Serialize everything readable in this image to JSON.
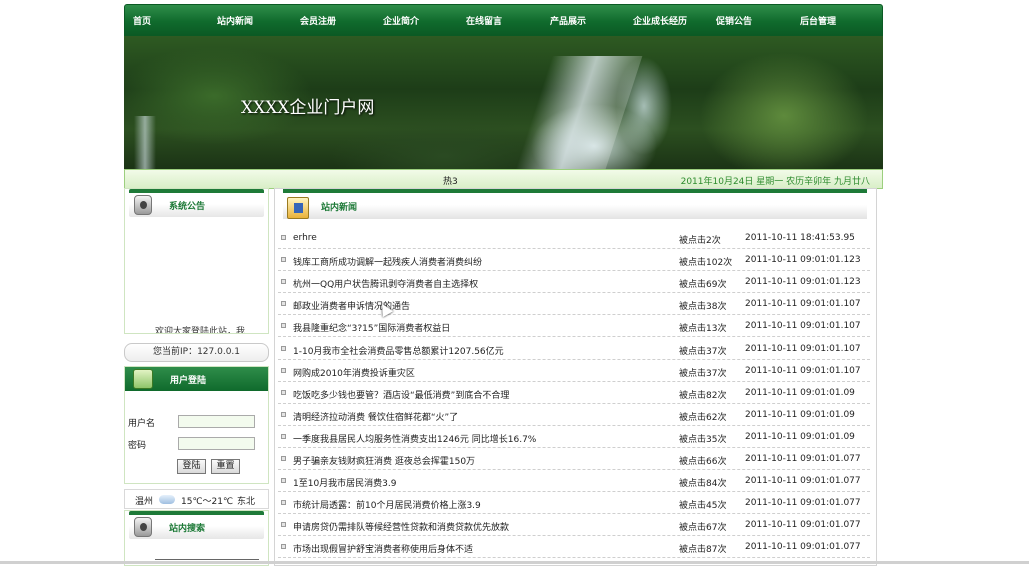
{
  "nav": [
    "首页",
    "站内新闻",
    "会员注册",
    "企业简介",
    "在线留言",
    "产品展示",
    "企业成长经历",
    "促销公告",
    "后台管理"
  ],
  "banner": {
    "title": "XXXX企业门户网"
  },
  "status": {
    "hot": "热3",
    "date": "2011年10月24日 星期一 农历辛卯年 九月廿八"
  },
  "notice": {
    "title": "系统公告",
    "scroll_text": "欢迎大家登陆此站，我"
  },
  "ip": {
    "text": "您当前IP：127.0.0.1"
  },
  "login": {
    "title": "用户登陆",
    "username_label": "用户名",
    "password_label": "密码",
    "username_value": "",
    "password_value": "",
    "login_button": "登陆",
    "reset_button": "重置"
  },
  "weather": {
    "city": "温州",
    "icon": "cloud-icon",
    "temp": "15℃～21℃",
    "wind": "东北"
  },
  "search": {
    "title": "站内搜索"
  },
  "news": {
    "title": "站内新闻",
    "rows": [
      {
        "title": "erhre",
        "clicks": "被点击2次",
        "date": "2011-10-11 18:41:53.95"
      },
      {
        "title": "钱库工商所成功调解一起残疾人消费者消费纠纷",
        "clicks": "被点击102次",
        "date": "2011-10-11 09:01:01.123"
      },
      {
        "title": "杭州一QQ用户状告腾讯剥夺消费者自主选择权",
        "clicks": "被点击69次",
        "date": "2011-10-11 09:01:01.123"
      },
      {
        "title": "邮政业消费者申诉情况的通告",
        "clicks": "被点击38次",
        "date": "2011-10-11 09:01:01.107"
      },
      {
        "title": "我县隆重纪念“3?15”国际消费者权益日",
        "clicks": "被点击13次",
        "date": "2011-10-11 09:01:01.107"
      },
      {
        "title": "1-10月我市全社会消费品零售总额累计1207.56亿元",
        "clicks": "被点击37次",
        "date": "2011-10-11 09:01:01.107"
      },
      {
        "title": "网购成2010年消费投诉重灾区",
        "clicks": "被点击37次",
        "date": "2011-10-11 09:01:01.107"
      },
      {
        "title": "吃饭吃多少钱也要管？酒店设“最低消费”到底合不合理",
        "clicks": "被点击82次",
        "date": "2011-10-11 09:01:01.09"
      },
      {
        "title": "清明经济拉动消费 餐饮住宿鲜花都“火”了",
        "clicks": "被点击62次",
        "date": "2011-10-11 09:01:01.09"
      },
      {
        "title": "一季度我县居民人均服务性消费支出1246元 同比增长16.7%",
        "clicks": "被点击35次",
        "date": "2011-10-11 09:01:01.09"
      },
      {
        "title": "男子骗亲友钱财疯狂消费 逛夜总会挥霍150万",
        "clicks": "被点击66次",
        "date": "2011-10-11 09:01:01.077"
      },
      {
        "title": "1至10月我市居民消费3.9",
        "clicks": "被点击84次",
        "date": "2011-10-11 09:01:01.077"
      },
      {
        "title": "市统计局透露：前10个月居民消费价格上涨3.9",
        "clicks": "被点击45次",
        "date": "2011-10-11 09:01:01.077"
      },
      {
        "title": "申请房贷仍需排队等候经营性贷款和消费贷款优先放款",
        "clicks": "被点击67次",
        "date": "2011-10-11 09:01:01.077"
      },
      {
        "title": "市场出现假冒护舒宝消费者称使用后身体不适",
        "clicks": "被点击87次",
        "date": "2011-10-11 09:01:01.077"
      }
    ]
  }
}
